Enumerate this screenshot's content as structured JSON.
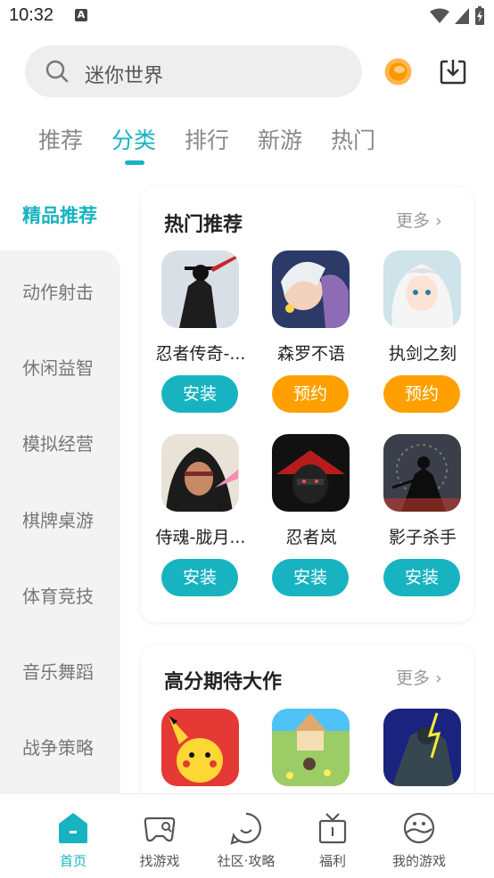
{
  "status_bar": {
    "time": "10:32",
    "notif": "A"
  },
  "search": {
    "placeholder": "迷你世界"
  },
  "tabs": [
    {
      "label": "推荐",
      "active": false
    },
    {
      "label": "分类",
      "active": true
    },
    {
      "label": "排行",
      "active": false
    },
    {
      "label": "新游",
      "active": false
    },
    {
      "label": "热门",
      "active": false
    }
  ],
  "sidebar": {
    "active": "精品推荐",
    "items": [
      "动作射击",
      "休闲益智",
      "模拟经营",
      "棋牌桌游",
      "体育竞技",
      "音乐舞蹈",
      "战争策略"
    ]
  },
  "hot": {
    "title": "热门推荐",
    "more": "更多",
    "apps": [
      {
        "name": "忍者传奇-...",
        "button": "安装",
        "type": "install"
      },
      {
        "name": "森罗不语",
        "button": "预约",
        "type": "reserve"
      },
      {
        "name": "执剑之刻",
        "button": "预约",
        "type": "reserve"
      },
      {
        "name": "侍魂-胧月...",
        "button": "安装",
        "type": "install"
      },
      {
        "name": "忍者岚",
        "button": "安装",
        "type": "install"
      },
      {
        "name": "影子杀手",
        "button": "安装",
        "type": "install"
      }
    ]
  },
  "high": {
    "title": "高分期待大作",
    "more": "更多"
  },
  "bottom_nav": [
    {
      "label": "首页",
      "icon": "home-icon"
    },
    {
      "label": "找游戏",
      "icon": "gamepad-icon"
    },
    {
      "label": "社区·攻略",
      "icon": "community-icon"
    },
    {
      "label": "福利",
      "icon": "gift-icon"
    },
    {
      "label": "我的游戏",
      "icon": "my-games-icon"
    }
  ],
  "colors": {
    "accent": "#17b3c1",
    "reserve": "#ffa000"
  }
}
